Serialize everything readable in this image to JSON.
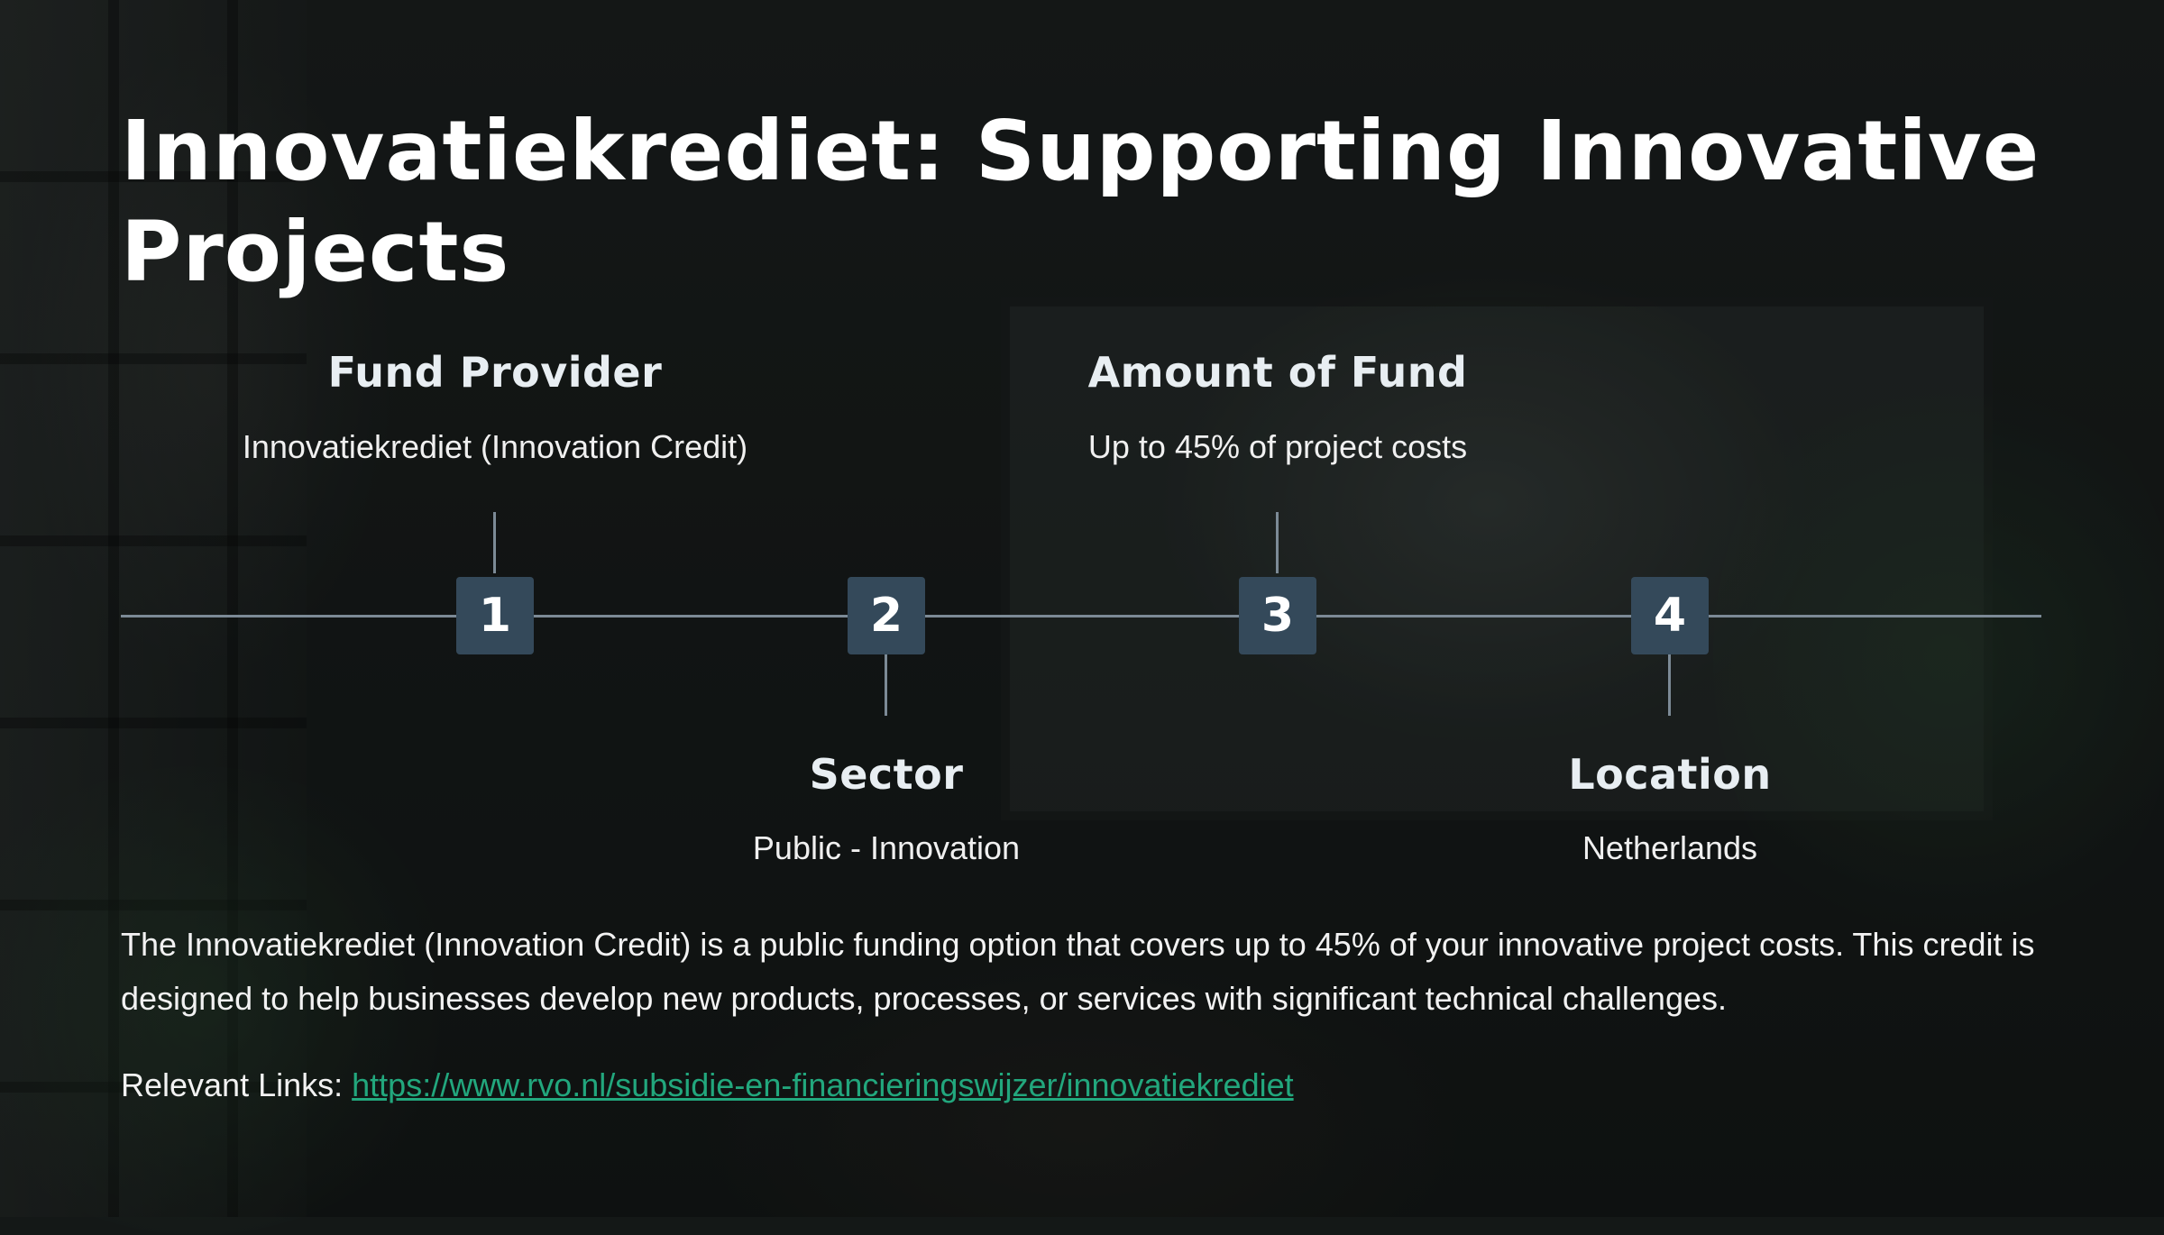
{
  "slide": {
    "title": "Innovatiekrediet: Supporting Innovative Projects",
    "accent_color": "#34495a",
    "link_color": "#22a77d"
  },
  "timeline": [
    {
      "number": "1",
      "heading": "Fund Provider",
      "text": "Innovatiekrediet (Innovation Credit)"
    },
    {
      "number": "2",
      "heading": "Sector",
      "text": "Public - Innovation"
    },
    {
      "number": "3",
      "heading": "Amount of Fund",
      "text": "Up to 45% of project costs"
    },
    {
      "number": "4",
      "heading": "Location",
      "text": "Netherlands"
    }
  ],
  "body": {
    "paragraph": "The Innovatiekrediet (Innovation Credit) is a public funding option that covers up to 45% of your innovative project costs. This credit is designed to help businesses develop new products, processes, or services with significant technical challenges.",
    "links_label": "Relevant Links: ",
    "link_url": "https://www.rvo.nl/subsidie-en-financieringswijzer/innovatiekrediet"
  }
}
